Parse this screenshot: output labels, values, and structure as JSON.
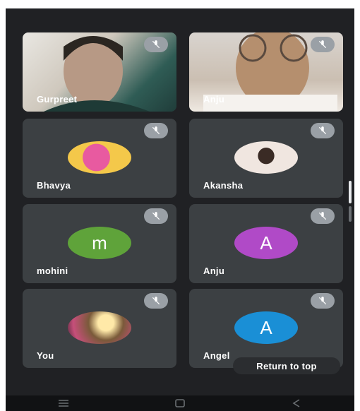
{
  "participants": [
    {
      "name": "Gurpreet",
      "type": "video",
      "accent": "#6fa39a"
    },
    {
      "name": "Anju",
      "type": "video",
      "accent": "#c9b7a6"
    },
    {
      "name": "Bhavya",
      "type": "image-avatar",
      "accent": "#f2c94c"
    },
    {
      "name": "Akansha",
      "type": "image-avatar",
      "accent": "#d9c7c0"
    },
    {
      "name": "mohini",
      "type": "letter-avatar",
      "letter": "m",
      "accent": "#5fa33a"
    },
    {
      "name": "Anju",
      "type": "letter-avatar",
      "letter": "A",
      "accent": "#b04ac7"
    },
    {
      "name": "You",
      "type": "image-avatar",
      "accent": "#8a5a4a"
    },
    {
      "name": "Angel",
      "type": "letter-avatar",
      "letter": "A",
      "accent": "#1a8fd6"
    }
  ],
  "overlay": {
    "return_to_top": "Return to top"
  },
  "icons": {
    "mute": "mic-off-icon",
    "nav_menu": "menu-icon",
    "nav_home": "home-icon",
    "nav_back": "back-icon"
  }
}
